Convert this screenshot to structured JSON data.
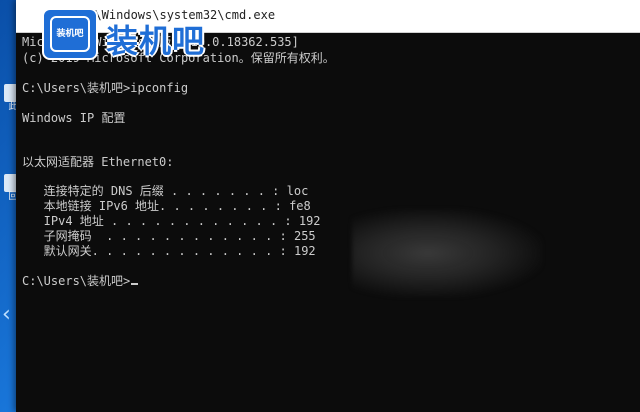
{
  "desktop": {
    "icons": [
      {
        "label": "此"
      },
      {
        "label": "回"
      }
    ]
  },
  "window": {
    "title": "C:\\Windows\\system32\\cmd.exe"
  },
  "logo": {
    "badge_text": "装机吧",
    "text": "装机吧"
  },
  "console": {
    "lines": [
      {
        "text": "Microsoft Windows [版本 10.0.18362.535]"
      },
      {
        "text": "(c) 2019 Microsoft Corporation。保留所有权利。"
      },
      {
        "text": ""
      },
      {
        "text": "C:\\Users\\装机吧>ipconfig"
      },
      {
        "text": ""
      },
      {
        "text": "Windows IP 配置"
      },
      {
        "text": ""
      },
      {
        "text": ""
      },
      {
        "text": "以太网适配器 Ethernet0:"
      },
      {
        "text": ""
      },
      {
        "text": "   连接特定的 DNS 后缀 . . . . . . . : loc"
      },
      {
        "text": "   本地链接 IPv6 地址. . . . . . . . : fe8"
      },
      {
        "text": "   IPv4 地址 . . . . . . . . . . . . : 192"
      },
      {
        "text": "   子网掩码  . . . . . . . . . . . . : 255"
      },
      {
        "text": "   默认网关. . . . . . . . . . . . . : 192"
      },
      {
        "text": ""
      },
      {
        "text": "C:\\Users\\装机吧>"
      }
    ]
  },
  "colors": {
    "console_bg": "#0c0c0c",
    "console_fg": "#cccccc",
    "logo_blue": "#1f6ed6"
  }
}
